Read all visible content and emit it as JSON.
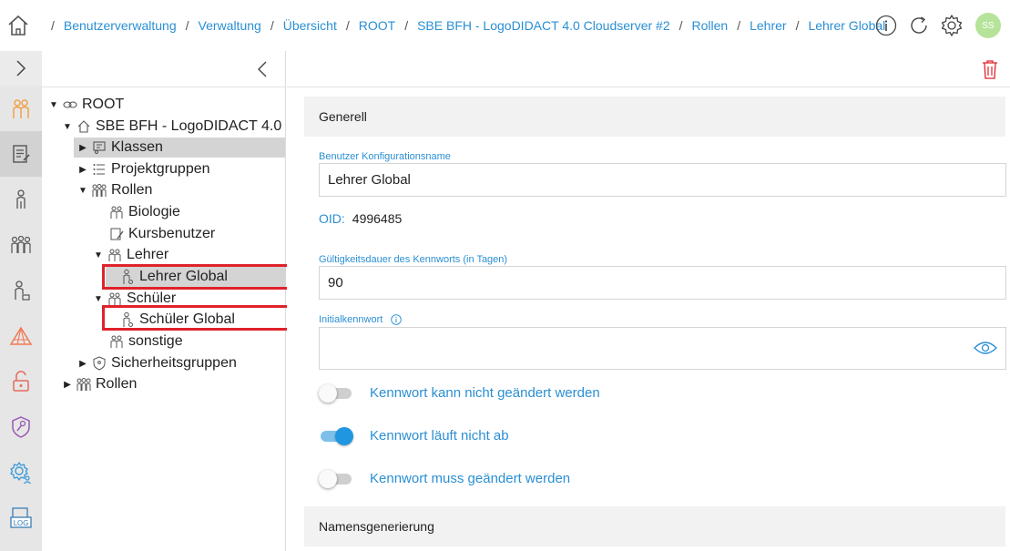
{
  "breadcrumb": {
    "items": [
      "Benutzerverwaltung",
      "Verwaltung",
      "Übersicht",
      "ROOT",
      "SBE BFH - LogoDIDACT 4.0 Cloudserver #2",
      "Rollen",
      "Lehrer",
      "Lehrer Global"
    ],
    "separator": "/"
  },
  "header": {
    "avatar_initials": "SS",
    "icons": [
      "home-icon",
      "info-icon",
      "refresh-icon",
      "gear-icon"
    ]
  },
  "rail": {
    "items": [
      "toggle",
      "users-group",
      "document-edit",
      "user",
      "group",
      "user-lock",
      "triangle",
      "unlock",
      "key-shield",
      "gear-users",
      "log"
    ],
    "active_index": 2
  },
  "tree": {
    "nodes": [
      {
        "label": "ROOT",
        "level": 0,
        "caret": "down",
        "icon": "link-icon"
      },
      {
        "label": "SBE BFH - LogoDIDACT 4.0",
        "level": 1,
        "caret": "down",
        "icon": "home-icon"
      },
      {
        "label": "Klassen",
        "level": 2,
        "caret": "right",
        "icon": "classroom-icon",
        "selected": true
      },
      {
        "label": "Projektgruppen",
        "level": 2,
        "caret": "right",
        "icon": "list-icon"
      },
      {
        "label": "Rollen",
        "level": 2,
        "caret": "down",
        "icon": "roles-icon"
      },
      {
        "label": "Biologie",
        "level": 3,
        "caret": "",
        "icon": "group-icon"
      },
      {
        "label": "Kursbenutzer",
        "level": 3,
        "caret": "",
        "icon": "edit-icon"
      },
      {
        "label": "Lehrer",
        "level": 3,
        "caret": "down",
        "icon": "group-icon"
      },
      {
        "label": "Lehrer Global",
        "level": 4,
        "caret": "",
        "icon": "user-config-icon",
        "selected": true,
        "highlight": true
      },
      {
        "label": "Schüler",
        "level": 3,
        "caret": "down",
        "icon": "group-icon"
      },
      {
        "label": "Schüler Global",
        "level": 4,
        "caret": "",
        "icon": "user-config-icon",
        "highlight": true
      },
      {
        "label": "sonstige",
        "level": 3,
        "caret": "",
        "icon": "group-icon"
      },
      {
        "label": "Sicherheitsgruppen",
        "level": 2,
        "caret": "right",
        "icon": "shield-icon"
      },
      {
        "label": "Rollen",
        "level": 1,
        "caret": "right",
        "icon": "roles-icon"
      }
    ]
  },
  "form": {
    "section_general": "Generell",
    "config_name_label": "Benutzer Konfigurationsname",
    "config_name_value": "Lehrer Global",
    "oid_label": "OID:",
    "oid_value": "4996485",
    "password_validity_label": "Gültigkeitsdauer des Kennworts (in Tagen)",
    "password_validity_value": "90",
    "initial_password_label": "Initialkennwort",
    "initial_password_value": "",
    "toggles": [
      {
        "label": "Kennwort kann nicht geändert werden",
        "on": false
      },
      {
        "label": "Kennwort läuft nicht ab",
        "on": true
      },
      {
        "label": "Kennwort muss geändert werden",
        "on": false
      }
    ],
    "section_naming": "Namensgenerierung"
  },
  "colors": {
    "accent": "#2a8fd4",
    "highlight_border": "#e0222b",
    "toggle_on": "#2196e0",
    "delete_icon": "#e0222b",
    "avatar_bg": "#b6e39a"
  }
}
